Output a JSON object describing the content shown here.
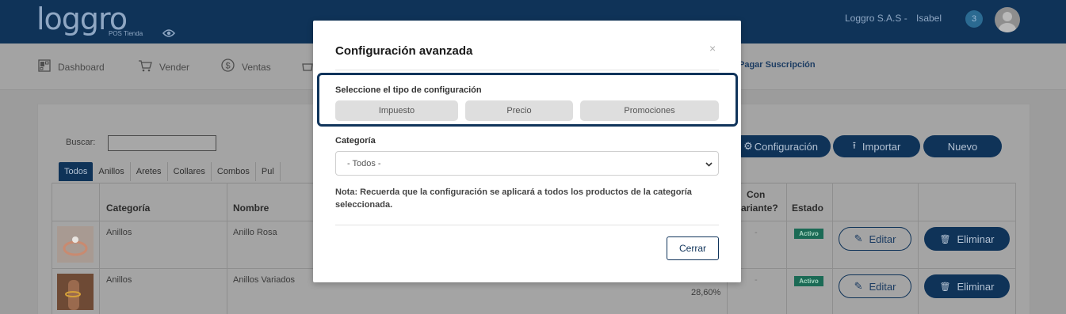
{
  "header": {
    "logo_text": "loggro",
    "logo_sub": "POS Tienda",
    "company": "Loggro S.A.S -",
    "user": "Isabel",
    "notification_count": "3"
  },
  "nav": {
    "items": [
      {
        "label": "Dashboard",
        "icon": "dashboard-icon"
      },
      {
        "label": "Vender",
        "icon": "cart-icon"
      },
      {
        "label": "Ventas",
        "icon": "dollar-icon"
      }
    ],
    "pay_label": "Pagar Suscripción"
  },
  "toolbar": {
    "search_label": "Buscar:",
    "config_label": "Configuración",
    "import_label": "Importar",
    "new_label": "Nuevo"
  },
  "category_tabs": [
    "Todos",
    "Anillos",
    "Aretes",
    "Collares",
    "Combos",
    "Pul"
  ],
  "table": {
    "headers": {
      "categoria": "Categoría",
      "nombre": "Nombre",
      "con_variante_1": "Con",
      "con_variante_2": "ariante?",
      "estado": "Estado"
    },
    "rows": [
      {
        "categoria": "Anillos",
        "nombre": "Anillo Rosa",
        "variante": "-",
        "estado": "Activo",
        "extra": ""
      },
      {
        "categoria": "Anillos",
        "nombre": "Anillos Variados",
        "variante": "-",
        "estado": "Activo",
        "extra": "28,60%"
      }
    ],
    "edit_label": "Editar",
    "delete_label": "Eliminar"
  },
  "modal": {
    "title": "Configuración avanzada",
    "close_symbol": "×",
    "type_label": "Seleccione el tipo de configuración",
    "type_options": [
      "Impuesto",
      "Precio",
      "Promociones"
    ],
    "category_label": "Categoría",
    "category_value": "- Todos -",
    "note": "Nota: Recuerda que la configuración se aplicará a todos los productos de la categoría seleccionada.",
    "close_button": "Cerrar"
  },
  "colors": {
    "brand_navy": "#0f3358",
    "status_green": "#1b6a55",
    "highlight_border": "#10345b"
  }
}
